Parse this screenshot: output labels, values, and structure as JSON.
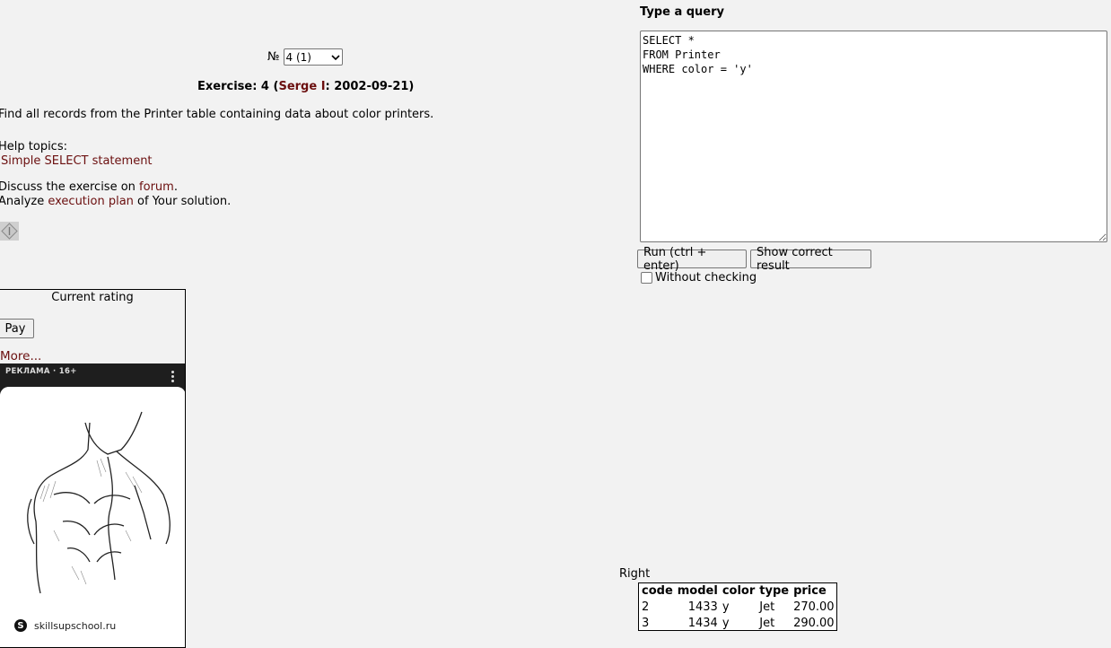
{
  "exercise_selector": {
    "number_label": "№",
    "selected": "4 (1)"
  },
  "exercise": {
    "title_prefix": "Exercise: 4 (",
    "author": "Serge I",
    "title_suffix": ": 2002-09-21)",
    "task": "Find all records from the Printer table containing data about color printers."
  },
  "help": {
    "label": "Help topics:",
    "topic_link": "Simple SELECT statement"
  },
  "discuss": {
    "prefix": "Discuss the exercise on ",
    "link": "forum",
    "suffix": "."
  },
  "analyze": {
    "prefix": "Analyze ",
    "link": "execution plan",
    "suffix": " of Your solution."
  },
  "rating": {
    "title": "Current rating",
    "pay_label": "Pay",
    "more_link": "More..."
  },
  "ad": {
    "label": "РЕКЛАМА · 16+",
    "site": "skillsupschool.ru",
    "logo_letter": "S"
  },
  "query": {
    "label": "Type a query",
    "text": "SELECT *\nFROM Printer\nWHERE color = 'y'"
  },
  "buttons": {
    "run": "Run (ctrl + enter)",
    "show_result": "Show correct result"
  },
  "without_checking": "Without checking",
  "result": {
    "label": "Right",
    "columns": [
      "code",
      "model",
      "color",
      "type",
      "price"
    ],
    "rows": [
      [
        "2",
        "1433",
        "y",
        "Jet",
        "270.00"
      ],
      [
        "3",
        "1434",
        "y",
        "Jet",
        "290.00"
      ]
    ]
  }
}
